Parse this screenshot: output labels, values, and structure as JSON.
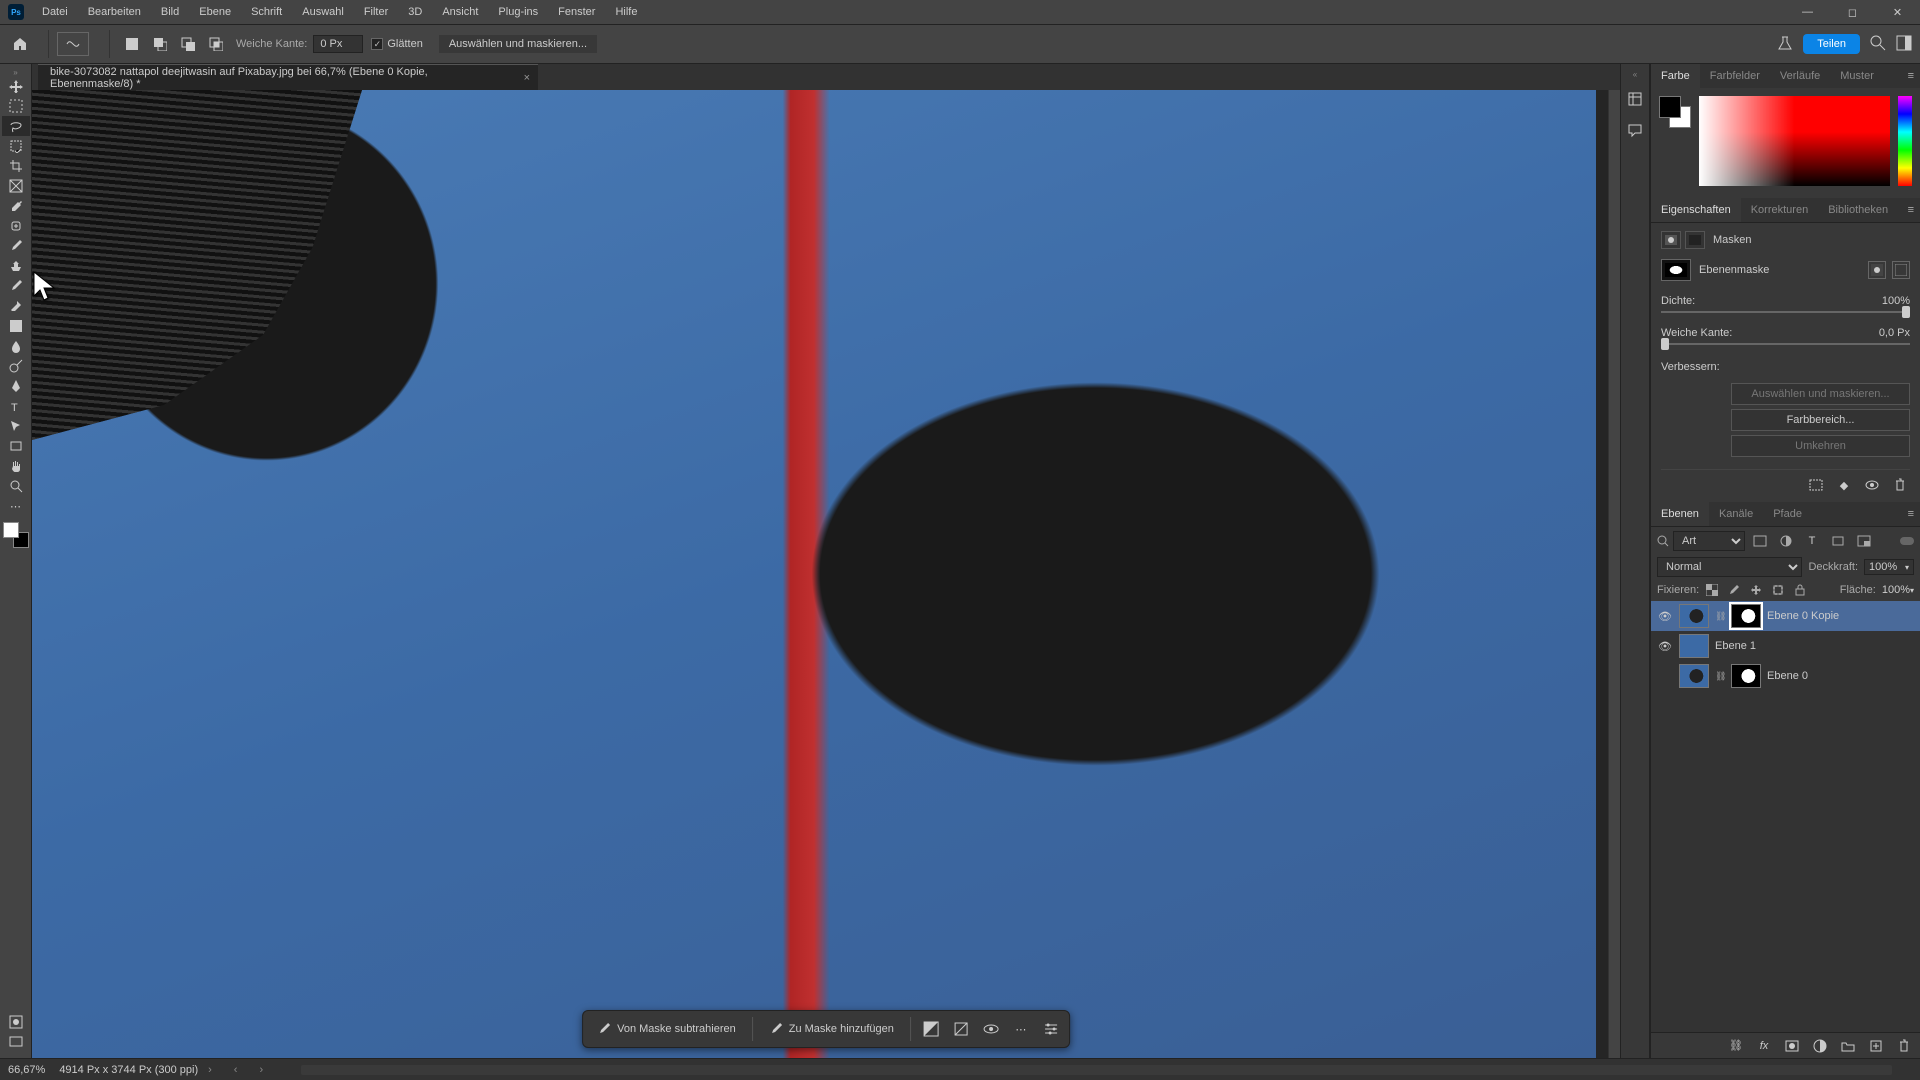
{
  "menu": {
    "items": [
      "Datei",
      "Bearbeiten",
      "Bild",
      "Ebene",
      "Schrift",
      "Auswahl",
      "Filter",
      "3D",
      "Ansicht",
      "Plug-ins",
      "Fenster",
      "Hilfe"
    ]
  },
  "options": {
    "weiche_kante_label": "Weiche Kante:",
    "weiche_kante_value": "0 Px",
    "glaetten_label": "Glätten",
    "select_mask_btn": "Auswählen und maskieren...",
    "share_btn": "Teilen"
  },
  "doc": {
    "tab_title": "bike-3073082 nattapol deejitwasin auf Pixabay.jpg bei 66,7% (Ebene 0 Kopie, Ebenenmaske/8) *"
  },
  "context": {
    "subtract": "Von Maske subtrahieren",
    "add": "Zu Maske hinzufügen"
  },
  "panels": {
    "color_tabs": [
      "Farbe",
      "Farbfelder",
      "Verläufe",
      "Muster"
    ],
    "props_tabs": [
      "Eigenschaften",
      "Korrekturen",
      "Bibliotheken"
    ],
    "layers_tabs": [
      "Ebenen",
      "Kanäle",
      "Pfade"
    ],
    "masks_label": "Masken",
    "layermask_label": "Ebenenmaske",
    "density_label": "Dichte:",
    "density_value": "100%",
    "feather_label": "Weiche Kante:",
    "feather_value": "0,0 Px",
    "refine_label": "Verbessern:",
    "select_mask_btn": "Auswählen und maskieren...",
    "color_range_btn": "Farbbereich...",
    "invert_btn": "Umkehren",
    "search_placeholder": "Art",
    "blend_mode": "Normal",
    "opacity_label": "Deckkraft:",
    "opacity_value": "100%",
    "lock_label": "Fixieren:",
    "fill_label": "Fläche:",
    "fill_value": "100%",
    "layers": [
      {
        "name": "Ebene 0 Kopie",
        "visible": true,
        "has_mask": true,
        "selected": true,
        "thumb": "img"
      },
      {
        "name": "Ebene 1",
        "visible": true,
        "has_mask": false,
        "selected": false,
        "thumb": "solid"
      },
      {
        "name": "Ebene 0",
        "visible": false,
        "has_mask": true,
        "selected": false,
        "thumb": "img"
      }
    ]
  },
  "status": {
    "zoom": "66,67%",
    "doc_info": "4914 Px x 3744 Px (300 ppi)"
  }
}
